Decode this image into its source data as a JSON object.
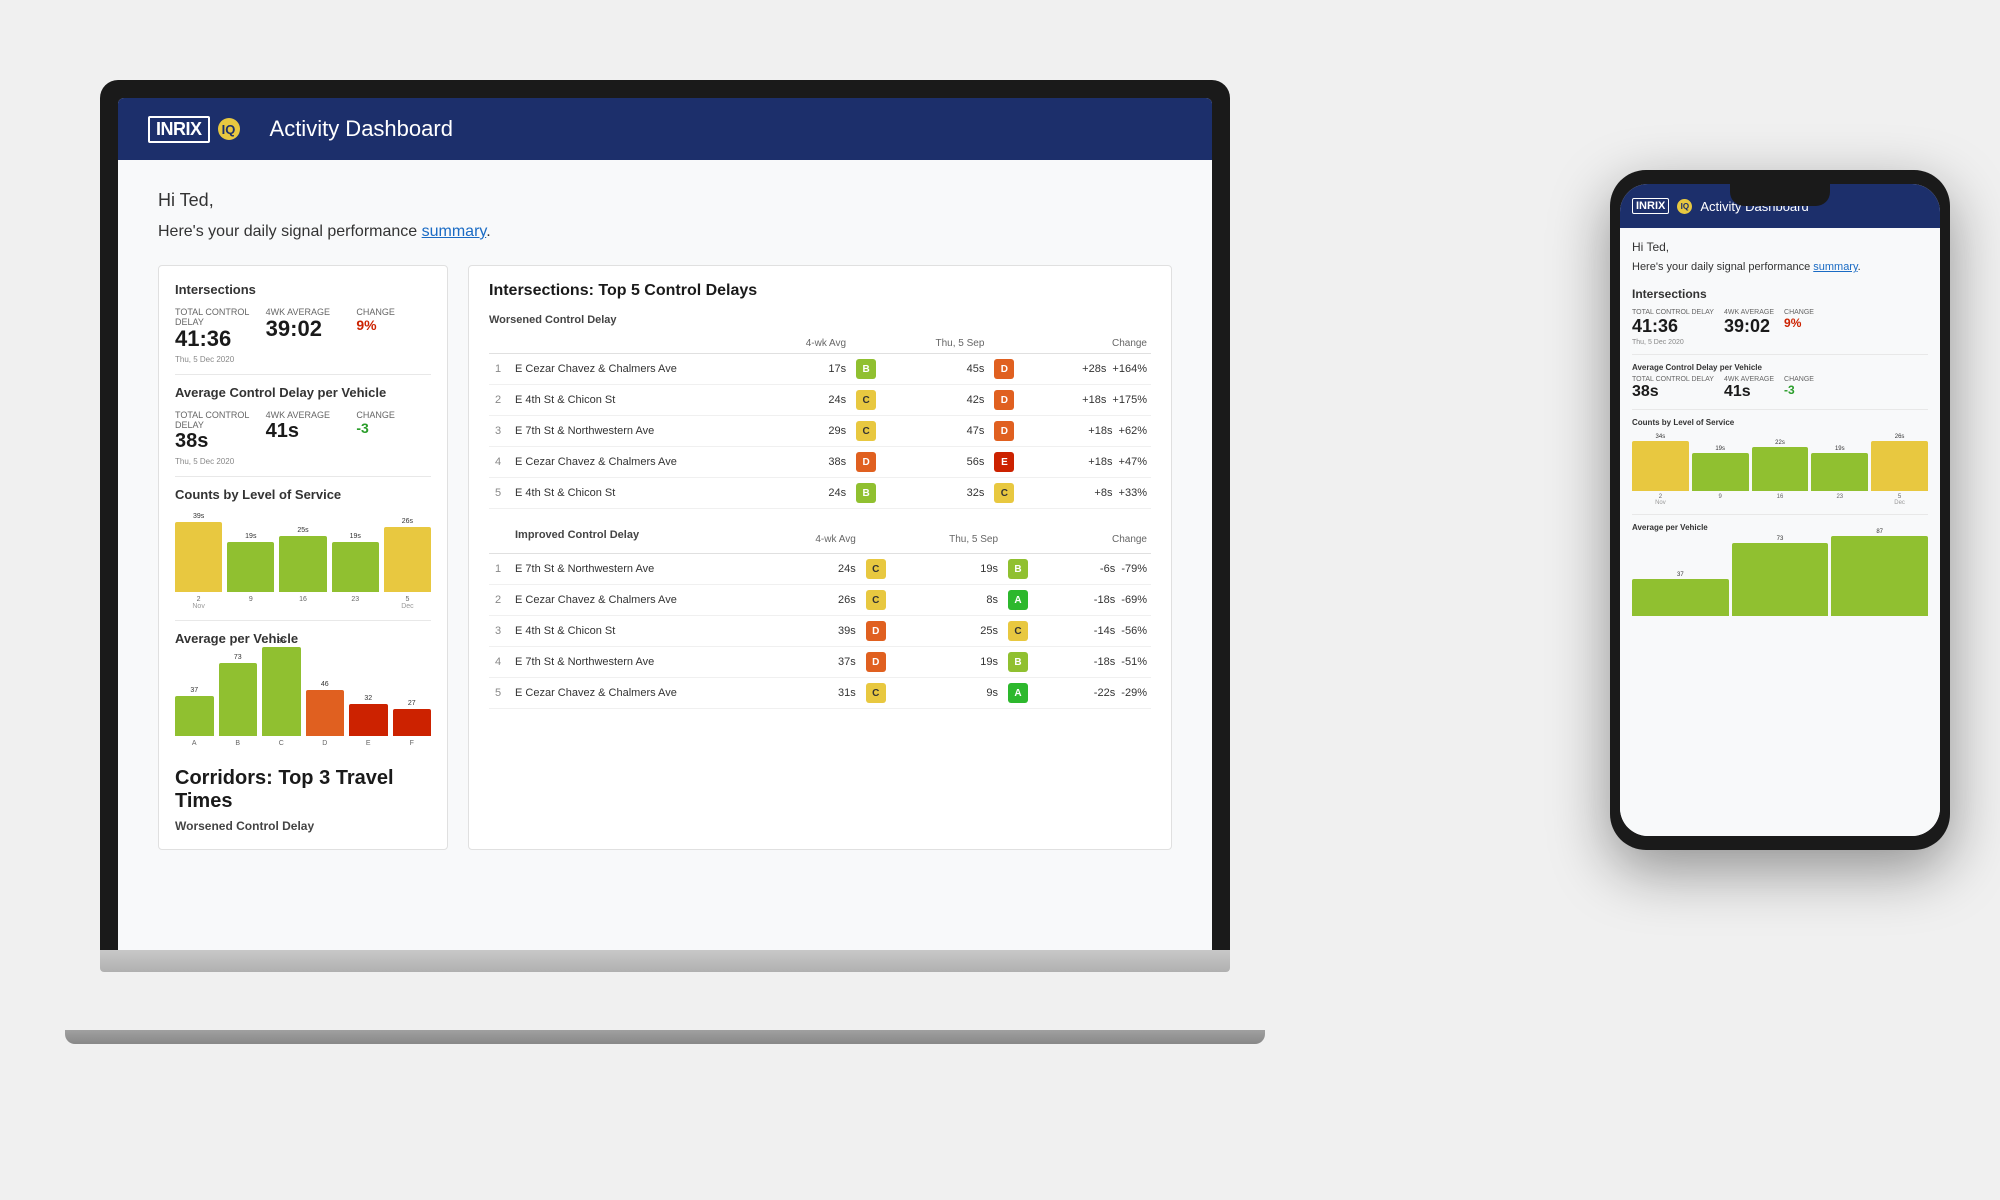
{
  "header": {
    "logo": "INRIX",
    "iq": "IQ",
    "title": "Activity Dashboard"
  },
  "greeting": "Hi Ted,",
  "summary_text": "Here's your daily signal performance ",
  "summary_link": "summary",
  "summary_end": ".",
  "intersections": {
    "section_title": "Intersections",
    "total_control_delay_label": "Total Control Delay",
    "avg_weekly_label": "4wk Average",
    "change_label": "Change",
    "total_value": "41:36",
    "avg_value": "39:02",
    "change_value": "9%",
    "date1": "Thu, 5 Dec 2020",
    "avg_per_vehicle_title": "Average Control Delay per Vehicle",
    "total_per_vehicle": "38s",
    "avg_per_vehicle": "41s",
    "change_per_vehicle": "-3",
    "date2": "Thu, 5 Dec 2020"
  },
  "counts_chart": {
    "title": "Counts by Level of Service",
    "bars": [
      {
        "label": "39s",
        "value": 70,
        "color": "#e8c840",
        "axis": "2"
      },
      {
        "label": "19s",
        "value": 50,
        "color": "#90c030",
        "axis": "9"
      },
      {
        "label": "25s",
        "value": 56,
        "color": "#90c030",
        "axis": "16"
      },
      {
        "label": "19s",
        "value": 50,
        "color": "#90c030",
        "axis": "23"
      },
      {
        "label": "26s",
        "value": 65,
        "color": "#e8c840",
        "axis": "5"
      }
    ],
    "axis_groups": [
      "Nov",
      "",
      "",
      "",
      "Dec"
    ]
  },
  "avg_per_vehicle_chart": {
    "title": "Average per Vehicle",
    "bars": [
      {
        "label": "37",
        "value": 40,
        "color": "#90c030",
        "axis": "A"
      },
      {
        "label": "73",
        "value": 73,
        "color": "#90c030",
        "axis": "B"
      },
      {
        "label": "89",
        "value": 89,
        "color": "#90c030",
        "axis": "C"
      },
      {
        "label": "46",
        "value": 46,
        "color": "#e06020",
        "axis": "D"
      },
      {
        "label": "32",
        "value": 32,
        "color": "#cc2200",
        "axis": "E"
      },
      {
        "label": "27",
        "value": 27,
        "color": "#cc2200",
        "axis": "F"
      }
    ]
  },
  "top5": {
    "title": "Intersections: Top 5 Control Delays",
    "worsened_label": "Worsened Control Delay",
    "improved_label": "Improved Control Delay",
    "columns": [
      "",
      "",
      "4-wk Avg",
      "",
      "Thu, 5 Sep",
      "",
      "Change"
    ],
    "worsened": [
      {
        "num": "1",
        "name": "E Cezar Chavez & Chalmers Ave",
        "avg_val": "17s",
        "avg_grade": "B",
        "cur_val": "45s",
        "cur_grade": "D",
        "change": "+28s",
        "pct": "+164%"
      },
      {
        "num": "2",
        "name": "E 4th St & Chicon St",
        "avg_val": "24s",
        "avg_grade": "C",
        "cur_val": "42s",
        "cur_grade": "D",
        "change": "+18s",
        "pct": "+175%"
      },
      {
        "num": "3",
        "name": "E 7th St & Northwestern Ave",
        "avg_val": "29s",
        "avg_grade": "C",
        "cur_val": "47s",
        "cur_grade": "D",
        "change": "+18s",
        "pct": "+62%"
      },
      {
        "num": "4",
        "name": "E Cezar Chavez & Chalmers Ave",
        "avg_val": "38s",
        "avg_grade": "D",
        "cur_val": "56s",
        "cur_grade": "E",
        "change": "+18s",
        "pct": "+47%"
      },
      {
        "num": "5",
        "name": "E 4th St & Chicon St",
        "avg_val": "24s",
        "avg_grade": "B",
        "cur_val": "32s",
        "cur_grade": "C",
        "change": "+8s",
        "pct": "+33%"
      }
    ],
    "improved": [
      {
        "num": "1",
        "name": "E 7th St & Northwestern Ave",
        "avg_val": "24s",
        "avg_grade": "C",
        "cur_val": "19s",
        "cur_grade": "B",
        "change": "-6s",
        "pct": "-79%"
      },
      {
        "num": "2",
        "name": "E Cezar Chavez & Chalmers Ave",
        "avg_val": "26s",
        "avg_grade": "C",
        "cur_val": "8s",
        "cur_grade": "A",
        "change": "-18s",
        "pct": "-69%"
      },
      {
        "num": "3",
        "name": "E 4th St & Chicon St",
        "avg_val": "39s",
        "avg_grade": "D",
        "cur_val": "25s",
        "cur_grade": "C",
        "change": "-14s",
        "pct": "-56%"
      },
      {
        "num": "4",
        "name": "E 7th St & Northwestern Ave",
        "avg_val": "37s",
        "avg_grade": "D",
        "cur_val": "19s",
        "cur_grade": "B",
        "change": "-18s",
        "pct": "-51%"
      },
      {
        "num": "5",
        "name": "E Cezar Chavez & Chalmers Ave",
        "avg_val": "31s",
        "avg_grade": "C",
        "cur_val": "9s",
        "cur_grade": "A",
        "change": "-22s",
        "pct": "-29%"
      }
    ]
  },
  "corridors": {
    "title": "Corridors: Top 3 Travel Times",
    "worsened_label": "Worsened Control Delay"
  }
}
